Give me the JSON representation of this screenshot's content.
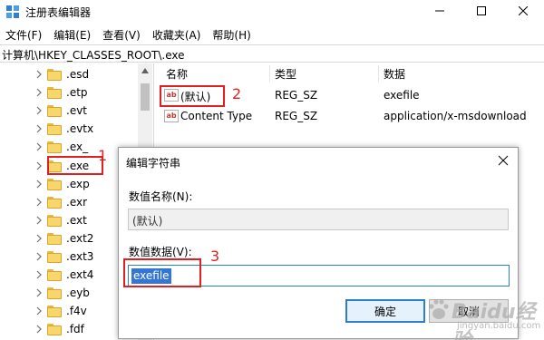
{
  "window": {
    "title": "注册表编辑器",
    "min_icon": "minimize-icon",
    "max_icon": "maximize-icon",
    "close_icon": "close-icon"
  },
  "menu": [
    "文件(F)",
    "编辑(E)",
    "查看(V)",
    "收藏夹(A)",
    "帮助(H)"
  ],
  "address": "计算机\\HKEY_CLASSES_ROOT\\.exe",
  "tree": {
    "items": [
      ".esd",
      ".etp",
      ".evt",
      ".evtx",
      ".ex_",
      ".exe",
      ".exp",
      ".exr",
      ".ext",
      ".ext2",
      ".ext3",
      ".ext4",
      ".eyb",
      ".f4v",
      ".fdf"
    ],
    "selected": ".exe"
  },
  "columns": {
    "name": "名称",
    "type": "类型",
    "data": "数据"
  },
  "values": [
    {
      "name": "(默认)",
      "type": "REG_SZ",
      "data": "exefile",
      "icon": "string-value-icon",
      "icon_text": "ab"
    },
    {
      "name": "Content Type",
      "type": "REG_SZ",
      "data": "application/x-msdownload",
      "icon": "string-value-icon",
      "icon_text": "ab"
    }
  ],
  "dialog": {
    "title": "编辑字符串",
    "name_label": "数值名称(N):",
    "name_value": "(默认)",
    "data_label": "数值数据(V):",
    "data_value": "exefile",
    "ok_label": "确定",
    "cancel_label": "取消"
  },
  "annotations": {
    "one": "1",
    "two": "2",
    "three": "3",
    "color": "#e02020"
  },
  "watermark": {
    "main": "Baidu经验",
    "sub": "jingyan.baidu.com"
  }
}
